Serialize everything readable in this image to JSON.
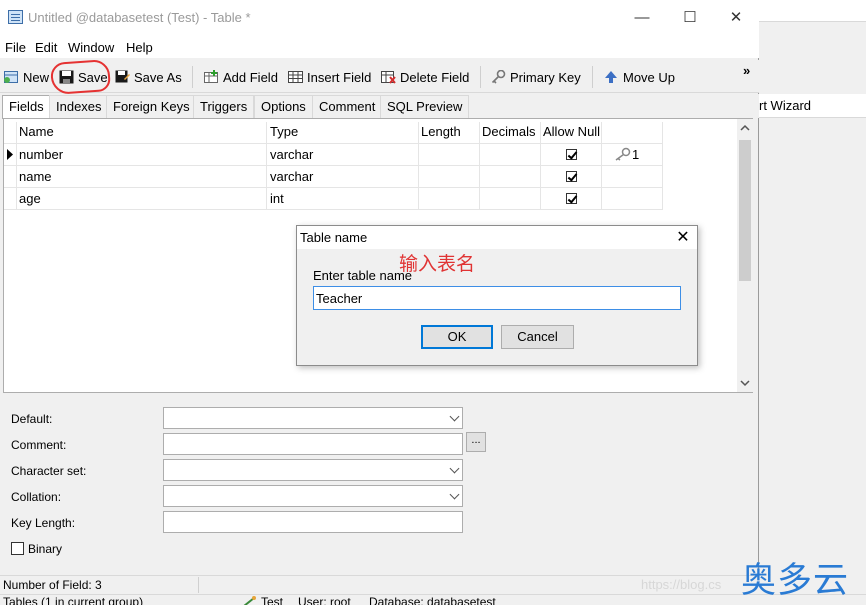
{
  "window": {
    "title": "Untitled @databasetest (Test) - Table *",
    "minimize_glyph": "—",
    "maximize_glyph": "☐",
    "close_glyph": "✕"
  },
  "background_window": {
    "tool_label": "rt Wizard"
  },
  "menu": [
    "File",
    "Edit",
    "Window",
    "Help"
  ],
  "toolbar": {
    "new": "New",
    "save": "Save",
    "save_as": "Save As",
    "add_field": "Add Field",
    "insert_field": "Insert Field",
    "delete_field": "Delete Field",
    "primary_key": "Primary Key",
    "move_up": "Move Up",
    "overflow": "»"
  },
  "tabs": [
    "Fields",
    "Indexes",
    "Foreign Keys",
    "Triggers",
    "Options",
    "Comment",
    "SQL Preview"
  ],
  "grid": {
    "columns": [
      "Name",
      "Type",
      "Length",
      "Decimals",
      "Allow Null",
      ""
    ],
    "rows": [
      {
        "name": "number",
        "type": "varchar",
        "length": "",
        "decimals": "",
        "allow_null": true,
        "key": "1"
      },
      {
        "name": "name",
        "type": "varchar",
        "length": "",
        "decimals": "",
        "allow_null": true,
        "key": ""
      },
      {
        "name": "age",
        "type": "int",
        "length": "",
        "decimals": "",
        "allow_null": true,
        "key": ""
      }
    ]
  },
  "dialog": {
    "title": "Table name",
    "annotation": "输入表名",
    "label": "Enter table name",
    "value": "Teacher",
    "ok": "OK",
    "cancel": "Cancel"
  },
  "properties": {
    "default": "Default:",
    "comment": "Comment:",
    "character_set": "Character set:",
    "collation": "Collation:",
    "key_length": "Key Length:",
    "binary": "Binary",
    "ellipsis": "..."
  },
  "status": {
    "field_count": "Number of Field: 3",
    "tables": "Tables (1 in current group)",
    "connection": "Test",
    "user": "User: root",
    "database": "Database: databasetest"
  },
  "watermark": {
    "url": "https://blog.cs",
    "brand": "奥多云"
  },
  "colors": {
    "highlight_circle": "#e53232",
    "annotation_text": "#e03333",
    "focus_border": "#0078d7",
    "watermark_brand": "#2a7bd4"
  }
}
